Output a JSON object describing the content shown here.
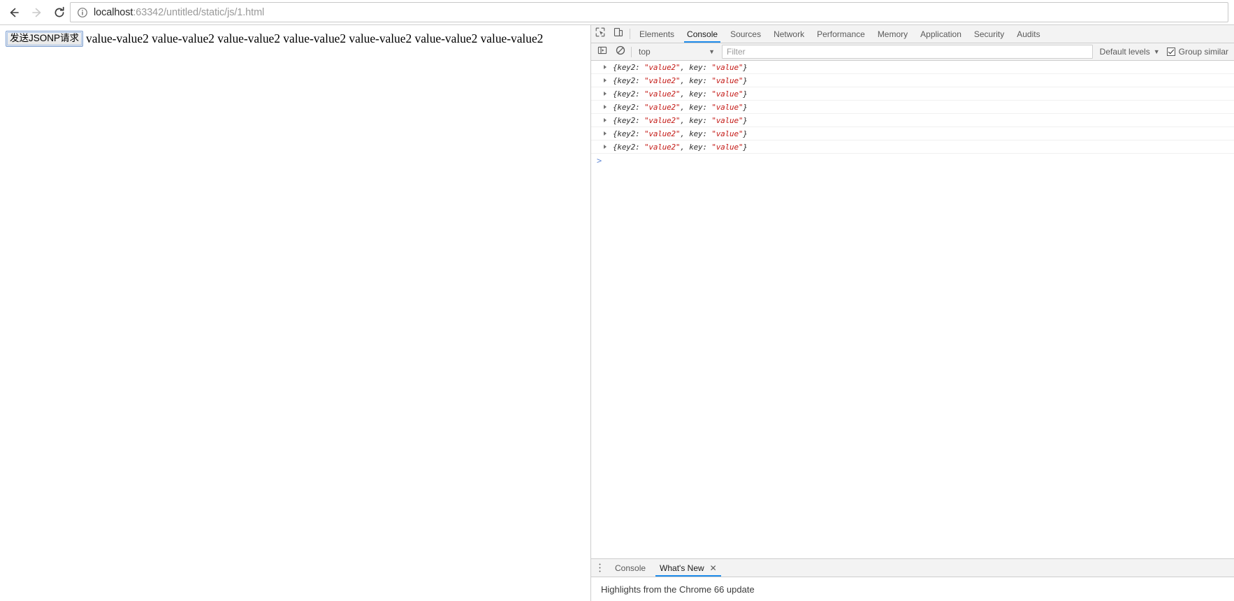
{
  "browser": {
    "back_icon": "arrow-left-icon",
    "forward_icon": "arrow-right-icon",
    "reload_icon": "reload-icon",
    "info_icon": "info-circle-icon",
    "url_host": "localhost",
    "url_rest": ":63342/untitled/static/js/1.html",
    "url_full": "localhost:63342/untitled/static/js/1.html"
  },
  "page": {
    "button_label": "发送JSONP请求",
    "body_text": "value-value2 value-value2 value-value2 value-value2 value-value2 value-value2 value-value2"
  },
  "devtools": {
    "inspect_icon": "inspect-element-icon",
    "device_icon": "device-toolbar-icon",
    "tabs": [
      {
        "label": "Elements",
        "active": false
      },
      {
        "label": "Console",
        "active": true
      },
      {
        "label": "Sources",
        "active": false
      },
      {
        "label": "Network",
        "active": false
      },
      {
        "label": "Performance",
        "active": false
      },
      {
        "label": "Memory",
        "active": false
      },
      {
        "label": "Application",
        "active": false
      },
      {
        "label": "Security",
        "active": false
      },
      {
        "label": "Audits",
        "active": false
      }
    ],
    "toolbar": {
      "sidebar_icon": "console-sidebar-icon",
      "clear_icon": "clear-console-icon",
      "context": "top",
      "context_caret": "▼",
      "filter_placeholder": "Filter",
      "filter_value": "",
      "levels_label": "Default levels",
      "levels_caret": "▼",
      "group_similar_label": "Group similar",
      "group_similar_checked": true
    },
    "console_messages": [
      {
        "disclosure": "▶",
        "open": "{key2: ",
        "v1": "\"value2\"",
        "mid": ", key: ",
        "v2": "\"value\"",
        "close": "}"
      },
      {
        "disclosure": "▶",
        "open": "{key2: ",
        "v1": "\"value2\"",
        "mid": ", key: ",
        "v2": "\"value\"",
        "close": "}"
      },
      {
        "disclosure": "▶",
        "open": "{key2: ",
        "v1": "\"value2\"",
        "mid": ", key: ",
        "v2": "\"value\"",
        "close": "}"
      },
      {
        "disclosure": "▶",
        "open": "{key2: ",
        "v1": "\"value2\"",
        "mid": ", key: ",
        "v2": "\"value\"",
        "close": "}"
      },
      {
        "disclosure": "▶",
        "open": "{key2: ",
        "v1": "\"value2\"",
        "mid": ", key: ",
        "v2": "\"value\"",
        "close": "}"
      },
      {
        "disclosure": "▶",
        "open": "{key2: ",
        "v1": "\"value2\"",
        "mid": ", key: ",
        "v2": "\"value\"",
        "close": "}"
      },
      {
        "disclosure": "▶",
        "open": "{key2: ",
        "v1": "\"value2\"",
        "mid": ", key: ",
        "v2": "\"value\"",
        "close": "}"
      }
    ],
    "prompt_arrow": ">",
    "drawer": {
      "menu_icon": "more-options-icon",
      "tabs": [
        {
          "label": "Console",
          "active": false,
          "closable": false,
          "close_glyph": ""
        },
        {
          "label": "What's New",
          "active": true,
          "closable": true,
          "close_glyph": "✕"
        }
      ],
      "content_text": "Highlights from the Chrome 66 update"
    }
  },
  "colors": {
    "accent_blue": "#1f8ceb",
    "string_red": "#c41a16",
    "toolbar_bg": "#f3f3f3",
    "border": "#cdcdcd",
    "prompt_blue": "#6a8fd8"
  }
}
